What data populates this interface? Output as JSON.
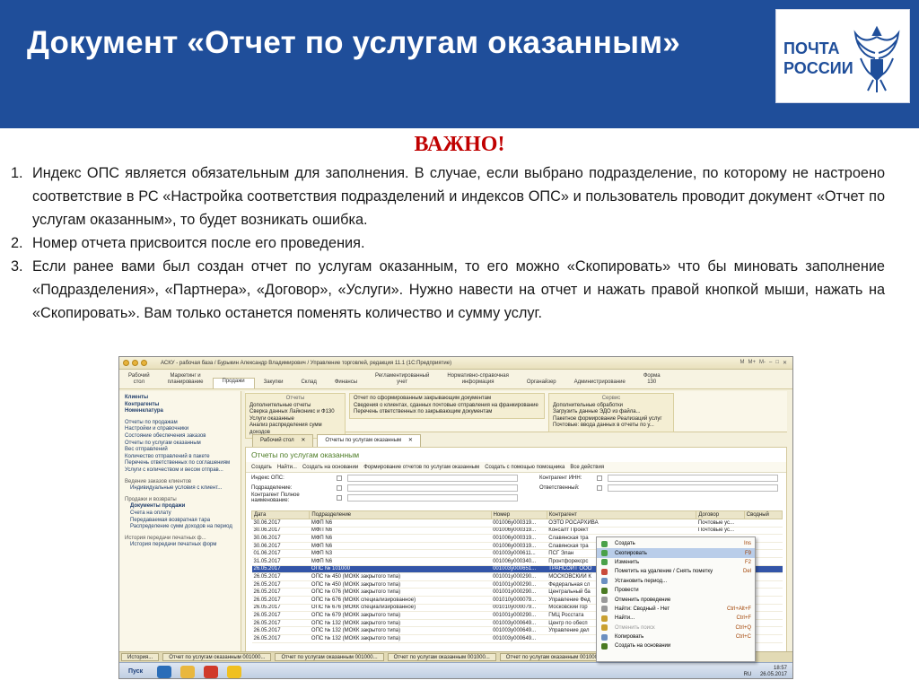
{
  "slide": {
    "title": "Документ «Отчет по услугам оказанным»",
    "logo": [
      "ПОЧТА",
      "РОССИИ"
    ],
    "important": "ВАЖНО!",
    "notes": [
      {
        "num": "1.",
        "text": "Индекс ОПС является обязательным для заполнения. В случае, если выбрано подразделение, по которому не настроено соответствие в РС «Настройка соответствия подразделений и индексов ОПС» и пользователь проводит документ «Отчет по услугам оказанным», то будет возникать ошибка."
      },
      {
        "num": "2.",
        "text": "Номер отчета присвоится после его проведения."
      },
      {
        "num": "3.",
        "text": "Если ранее вами был создан отчет по услугам оказанным, то его можно «Скопировать» что бы миновать заполнение «Подразделения», «Партнера», «Договор», «Услуги». Нужно навести на отчет и нажать правой кнопкой мыши, нажать на «Скопировать». Вам только останется поменять количество и сумму услуг."
      }
    ]
  },
  "app": {
    "window_title": "АСКУ - рабочая база / Бурыкин Александр Владимирович / Управление торговлей, редакция 11.1  (1С:Предприятие)",
    "window_right": [
      "M",
      "M+",
      "M-"
    ],
    "sections": [
      {
        "label": "Рабочий\nстол",
        "active": false
      },
      {
        "label": "Маркетинг и\nпланирование",
        "active": false
      },
      {
        "label": "Продажи",
        "active": true
      },
      {
        "label": "Закупки",
        "active": false
      },
      {
        "label": "Склад",
        "active": false
      },
      {
        "label": "Финансы",
        "active": false
      },
      {
        "label": "Регламентированный\nучет",
        "active": false
      },
      {
        "label": "Нормативно-справочная\nинформация",
        "active": false
      },
      {
        "label": "Органайзер",
        "active": false
      },
      {
        "label": "Администрирование",
        "active": false
      },
      {
        "label": "Форма\n130",
        "active": false
      }
    ],
    "nav": {
      "top": [
        "Клиенты",
        "Контрагенты",
        "Номенклатура"
      ],
      "links": [
        "Отчеты по продажам",
        "Настройки и справочники",
        "Состояние обеспечения заказов",
        "Отчеты по услугам оказанным",
        "Вес отправлений",
        "Количество отправлений в пакете",
        "Перечень ответственных по соглашениям",
        "Услуги с количеством и весом отправ..."
      ],
      "group1_head": "Ведение заказов клиентов",
      "group1": [
        "Индивидуальные условия с клиент..."
      ],
      "group2_head": "Продажи и возвраты",
      "group2": [
        "Документы продажи",
        "Счета на оплату",
        "Передаваемая возвратная тара",
        "Распределение сумм доходов на период"
      ],
      "group3_head": "История передачи печатных ф...",
      "group3": [
        "История передачи печатных форм"
      ]
    },
    "cmd_groups": [
      {
        "head": "Отчеты",
        "items": [
          "Дополнительные отчеты",
          "Сверка данных Лайконикс и Ф130",
          "Услуги оказанные",
          "Анализ распределения сумм доходов"
        ]
      },
      {
        "head": "",
        "items": [
          "Отчет по сформированным закрывающим документам",
          "Сведения о клиентах, сданных почтовые отправления на франкирование",
          "Перечень ответственных по закрывающим документам"
        ]
      },
      {
        "head": "Сервис",
        "items": [
          "Дополнительные обработки",
          "Загрузить данные ЭДО из файла...",
          "Пакетное формирование Реализаций услуг",
          "Почтовые: ввода данных в отчеты по у..."
        ]
      }
    ],
    "tabs": [
      {
        "label": "Рабочий стол",
        "active": false
      },
      {
        "label": "Отчеты по услугам оказанным",
        "active": true
      }
    ],
    "form": {
      "title": "Отчеты по услугам оказанным",
      "toolbar": [
        "Создать",
        "Найти...",
        "Создать на основании",
        "Формирование отчетов по услугам оказанным",
        "Создать с помощью помощника",
        "Все действия"
      ],
      "filters": [
        {
          "label": "Индекс ОПС:",
          "label2": "Контрагент ИНН:"
        },
        {
          "label": "Подразделение:",
          "label2": "Ответственный:"
        },
        {
          "label": "Контрагент Полное наименование:",
          "label2": ""
        }
      ],
      "columns": [
        "Дата",
        "Подразделение",
        "Номер",
        "Контрагент",
        "Договор",
        "Сводный"
      ],
      "rows": [
        [
          "30.06.2017",
          "МФП N6",
          "001006у000319...",
          "ОЭТО РОСАРХИВА",
          "Почтовые ус...",
          ""
        ],
        [
          "30.06.2017",
          "МФП N6",
          "001006у000319...",
          "Консалт Проект",
          "Почтовые ус...",
          ""
        ],
        [
          "30.06.2017",
          "МФП N6",
          "001006у000319...",
          "Славянская тра",
          "",
          ""
        ],
        [
          "30.06.2017",
          "МФП N6",
          "001006у000319...",
          "Славянская тра",
          "",
          ""
        ],
        [
          "01.06.2017",
          "МФП N3",
          "001003у000611...",
          "ПСГ Элан",
          "",
          ""
        ],
        [
          "31.05.2017",
          "МФП N6",
          "001006у000340...",
          "Пронтфорексрс",
          "",
          ""
        ],
        [
          "26.05.2017",
          "ОПС № 101000",
          "001003у000651...",
          "ТРАНСОЙТ ООО",
          "",
          ""
        ],
        [
          "26.05.2017",
          "ОПС № 450 (МОКК закрытого типа)",
          "001001у000290...",
          "МОСКОВСКИЙ К",
          "",
          ""
        ],
        [
          "26.05.2017",
          "ОПС № 450 (МОКК закрытого типа)",
          "001001у000290...",
          "Федеральная сл",
          "",
          ""
        ],
        [
          "26.05.2017",
          "ОПС № 076 (МОКК закрытого типа)",
          "001001у000290...",
          "Центральный ба",
          "",
          ""
        ],
        [
          "26.05.2017",
          "ОПС № 676 (МОКК специализированное)",
          "001010у000079...",
          "Управление Фед",
          "",
          ""
        ],
        [
          "26.05.2017",
          "ОПС № 676 (МОКК специализированное)",
          "001010у000079...",
          "Московский гор",
          "",
          ""
        ],
        [
          "26.05.2017",
          "ОПС № 679 (МОКК закрытого типа)",
          "001001у000290...",
          "ГМЦ Росстата",
          "",
          ""
        ],
        [
          "26.05.2017",
          "ОПС № 132 (МОКК закрытого типа)",
          "001003у000649...",
          "Центр по обесп",
          "",
          ""
        ],
        [
          "26.05.2017",
          "ОПС № 132 (МОКК закрытого типа)",
          "001003у000649...",
          "Управление дел",
          "",
          ""
        ],
        [
          "26.05.2017",
          "ОПС № 132 (МОКК закрытого типа)",
          "001003у000649...",
          "",
          "",
          ""
        ]
      ],
      "selected_row": 6
    },
    "context_menu": [
      {
        "label": "Создать",
        "key": "Ins",
        "state": ""
      },
      {
        "label": "Скопировать",
        "key": "F9",
        "state": "hi"
      },
      {
        "label": "Изменить",
        "key": "F2",
        "state": ""
      },
      {
        "label": "Пометить на удаление / Снять пометку",
        "key": "Del",
        "state": ""
      },
      {
        "label": "Установить период...",
        "key": "",
        "state": ""
      },
      {
        "label": "Провести",
        "key": "",
        "state": ""
      },
      {
        "label": "Отменить проведение",
        "key": "",
        "state": ""
      },
      {
        "label": "Найти: Сводный - Нет",
        "key": "Ctrl+Alt+F",
        "state": ""
      },
      {
        "label": "Найти...",
        "key": "Ctrl+F",
        "state": ""
      },
      {
        "label": "Отменить поиск",
        "key": "Ctrl+Q",
        "state": "dis"
      },
      {
        "label": "Копировать",
        "key": "Ctrl+C",
        "state": ""
      },
      {
        "label": "Создать на основании",
        "key": "",
        "state": ""
      }
    ],
    "window_tabs": [
      "История...",
      "Отчет по услугам оказанным 001000...",
      "Отчет по услугам оказанным 001000...",
      "Отчет по услугам оказанным 001000...",
      "Отчет по услугам оказанным 001000..."
    ],
    "taskbar": {
      "start": "Пуск",
      "lang": "RU",
      "time": "18:57",
      "date": "26.05.2017"
    },
    "colors": {
      "accent": "#1f4e9a",
      "selected": "#3355a8",
      "form_title": "#4a7a22",
      "important": "#c00000"
    }
  }
}
